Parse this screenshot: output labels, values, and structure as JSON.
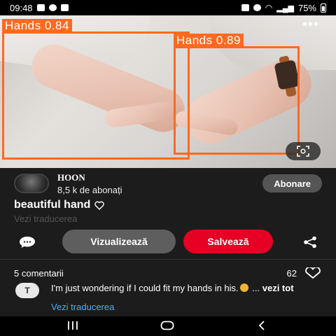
{
  "status_bar": {
    "time": "09:48",
    "battery": "75%"
  },
  "detections": [
    {
      "label": "Hands 0.84"
    },
    {
      "label": "Hands 0.89"
    }
  ],
  "photo": {
    "more_icon": "more-dots-icon",
    "lens_icon": "visual-search-icon"
  },
  "author": {
    "name": "HOON",
    "subscribers": "8,5 k de abonați",
    "follow_label": "Abonare"
  },
  "pin": {
    "title": "beautiful hand",
    "translate": "Vezi traducerea"
  },
  "actions": {
    "visit_label": "Vizualizează",
    "save_label": "Salvează",
    "save_color": "#e60023",
    "visit_color": "#5e5e5e"
  },
  "comments": {
    "count_label": "5 comentarii",
    "likes": "62",
    "first": {
      "avatar_initial": "T",
      "text": "I'm just wondering if I could fit my hands in his.",
      "ellipsis": "...",
      "see_more": "vezi tot",
      "translate": "Vezi traducerea"
    }
  },
  "accent_color": "#ff6a1f"
}
